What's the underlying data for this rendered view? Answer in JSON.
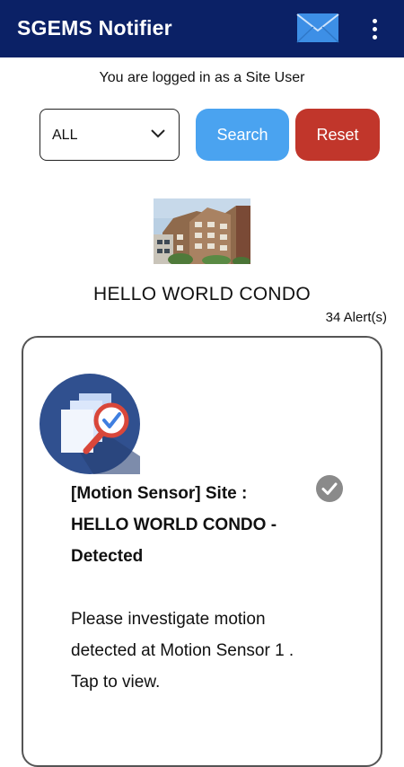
{
  "appbar": {
    "title": "SGEMS Notifier",
    "mail_icon": "mail-icon",
    "menu_icon": "more-vert-icon",
    "bg_color": "#0b2166"
  },
  "session": {
    "login_text": "You are logged in as a Site User"
  },
  "filter": {
    "selected": "ALL",
    "icon": "chevron-down-icon"
  },
  "actions": {
    "search_label": "Search",
    "reset_label": "Reset",
    "search_color": "#4aa3f0",
    "reset_color": "#c1362b"
  },
  "site": {
    "name": "HELLO WORLD CONDO",
    "alert_count": "34 Alert(s)"
  },
  "alerts": [
    {
      "title": "[Motion Sensor] Site : HELLO WORLD CONDO - Detected",
      "message": "Please investigate motion detected at Motion Sensor 1 . Tap to view.",
      "icon": "document-search-icon",
      "status_icon": "check-circle-icon"
    }
  ]
}
